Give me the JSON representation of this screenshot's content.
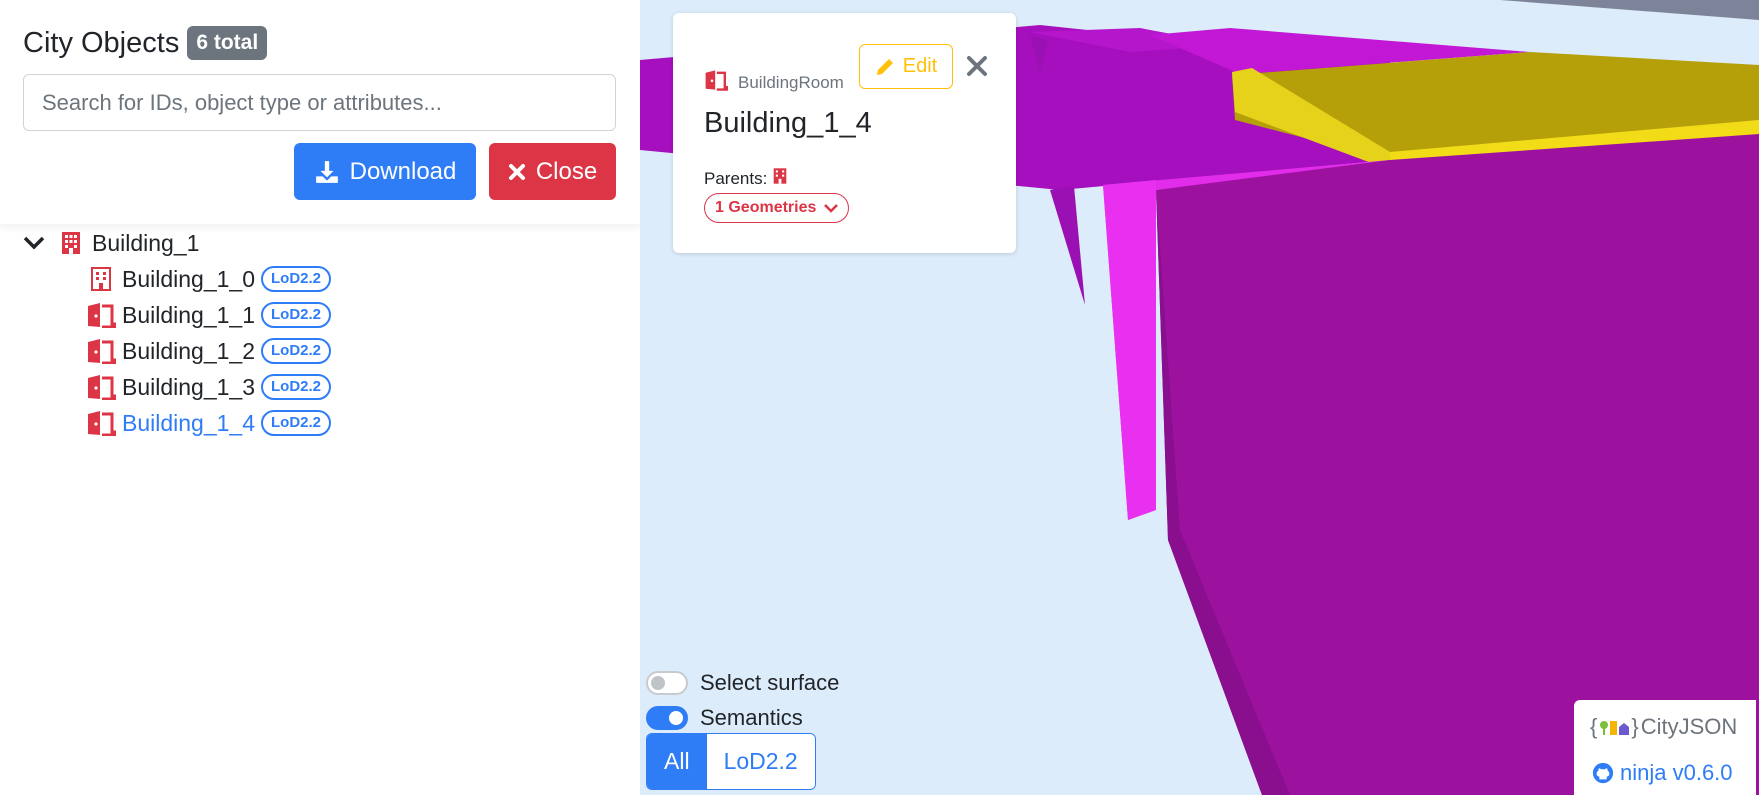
{
  "sidebar": {
    "title": "City Objects",
    "total_badge": "6 total",
    "search_placeholder": "Search for IDs, object type or attributes...",
    "download_label": "Download",
    "close_label": "Close",
    "tree": {
      "root": {
        "label": "Building_1",
        "icon": "building-icon"
      },
      "children": [
        {
          "label": "Building_1_0",
          "lod": "LoD2.2",
          "icon": "building-icon"
        },
        {
          "label": "Building_1_1",
          "lod": "LoD2.2",
          "icon": "door-icon"
        },
        {
          "label": "Building_1_2",
          "lod": "LoD2.2",
          "icon": "door-icon"
        },
        {
          "label": "Building_1_3",
          "lod": "LoD2.2",
          "icon": "door-icon"
        },
        {
          "label": "Building_1_4",
          "lod": "LoD2.2",
          "icon": "door-icon",
          "selected": true
        }
      ]
    }
  },
  "info_card": {
    "type_label": "BuildingRoom",
    "object_id": "Building_1_4",
    "edit_label": "Edit",
    "parents_label": "Parents:",
    "geometries_label": "1 Geometries"
  },
  "viewer": {
    "select_surface_label": "Select surface",
    "select_surface_on": false,
    "semantics_label": "Semantics",
    "semantics_on": true,
    "lod_options": [
      "All",
      "LoD2.2"
    ],
    "lod_active": "All"
  },
  "brand": {
    "logo_text": "CityJSON",
    "link_text": "ninja v0.6.0"
  },
  "colors": {
    "primary": "#2e7cf6",
    "danger": "#dc3545",
    "warning": "#ffc107",
    "secondary": "#6c757d",
    "wall": "#9b0fb0",
    "roof": "#b5a00a"
  }
}
